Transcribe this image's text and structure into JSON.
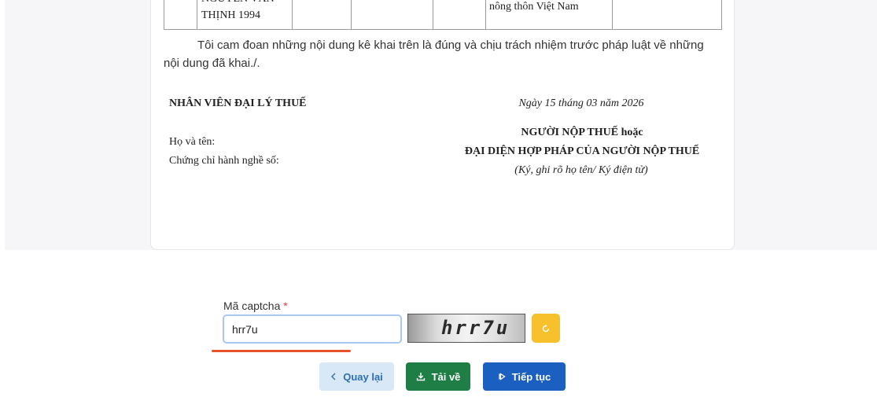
{
  "table_fragment": {
    "col2_top_cut": "NGUYỄN VĂN",
    "col2_line": "THỊNH 1994",
    "col6_line": "nông thôn Việt Nam"
  },
  "declaration": "Tôi cam đoan những nội dung kê khai trên là đúng và chịu trách nhiệm trước pháp luật về những nội dung đã khai./.",
  "agent": {
    "title": "NHÂN VIÊN ĐẠI LÝ THUẾ",
    "name_label": "Họ và tên:",
    "cert_label": "Chứng chỉ hành nghề số:"
  },
  "signature": {
    "date": "Ngày 15 tháng 03 năm 2026",
    "title_line1": "NGƯỜI NỘP THUẾ hoặc",
    "title_line2": "ĐẠI DIỆN HỢP PHÁP CỦA NGƯỜI NỘP THUẾ",
    "note": "(Ký, ghi rõ họ tên/ Ký điện tử)"
  },
  "captcha": {
    "label": "Mã captcha",
    "required_mark": "*",
    "value": "hrr7u",
    "image_text": "hrr7u"
  },
  "buttons": {
    "back": "Quay lại",
    "download": "Tải về",
    "next": "Tiếp tục"
  },
  "colors": {
    "refresh": "#f6c12c",
    "download": "#1e7e45",
    "next": "#1b5fc1",
    "back_bg": "#d8e8f6"
  },
  "icons": {
    "back": "chevron-left-icon",
    "download": "download-icon",
    "next": "skip-next-icon",
    "refresh": "refresh-icon"
  }
}
